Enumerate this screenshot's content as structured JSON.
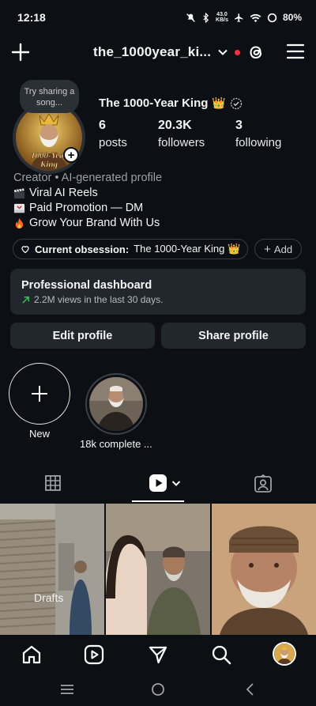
{
  "status": {
    "time": "12:18",
    "netspeed_top": "43.0",
    "netspeed_bottom": "KB/s",
    "battery": "80%"
  },
  "header": {
    "username": "the_1000year_ki..."
  },
  "profile": {
    "note": "Try sharing a song...",
    "display_name": "The 1000-Year King",
    "crown": "👑",
    "avatar_caption": "1000-Year King",
    "stats": [
      {
        "value": "6",
        "label": "posts"
      },
      {
        "value": "20.3K",
        "label": "followers"
      },
      {
        "value": "3",
        "label": "following"
      }
    ],
    "bio": {
      "category": "Creator • AI-generated profile",
      "lines": [
        {
          "icon": "clapper-board-icon",
          "text": "Viral AI Reels"
        },
        {
          "icon": "inbox-tray-icon",
          "text": "Paid Promotion — DM"
        },
        {
          "icon": "fire-icon",
          "text": "Grow Your Brand With Us"
        }
      ]
    },
    "obsession": {
      "label": "Current obsession:",
      "value": "The 1000-Year King 👑"
    },
    "add_label": "Add"
  },
  "dashboard": {
    "title": "Professional dashboard",
    "subtitle": "2.2M views in the last 30 days."
  },
  "buttons": {
    "edit": "Edit profile",
    "share": "Share profile"
  },
  "highlights": [
    {
      "label": "New"
    },
    {
      "label": "18k complete ..."
    }
  ],
  "grid": {
    "drafts_label": "Drafts"
  },
  "colors": {
    "background": "#0c0f14",
    "surface": "#22262d",
    "accent_red": "#ff2d40",
    "trend_green": "#34c759"
  }
}
